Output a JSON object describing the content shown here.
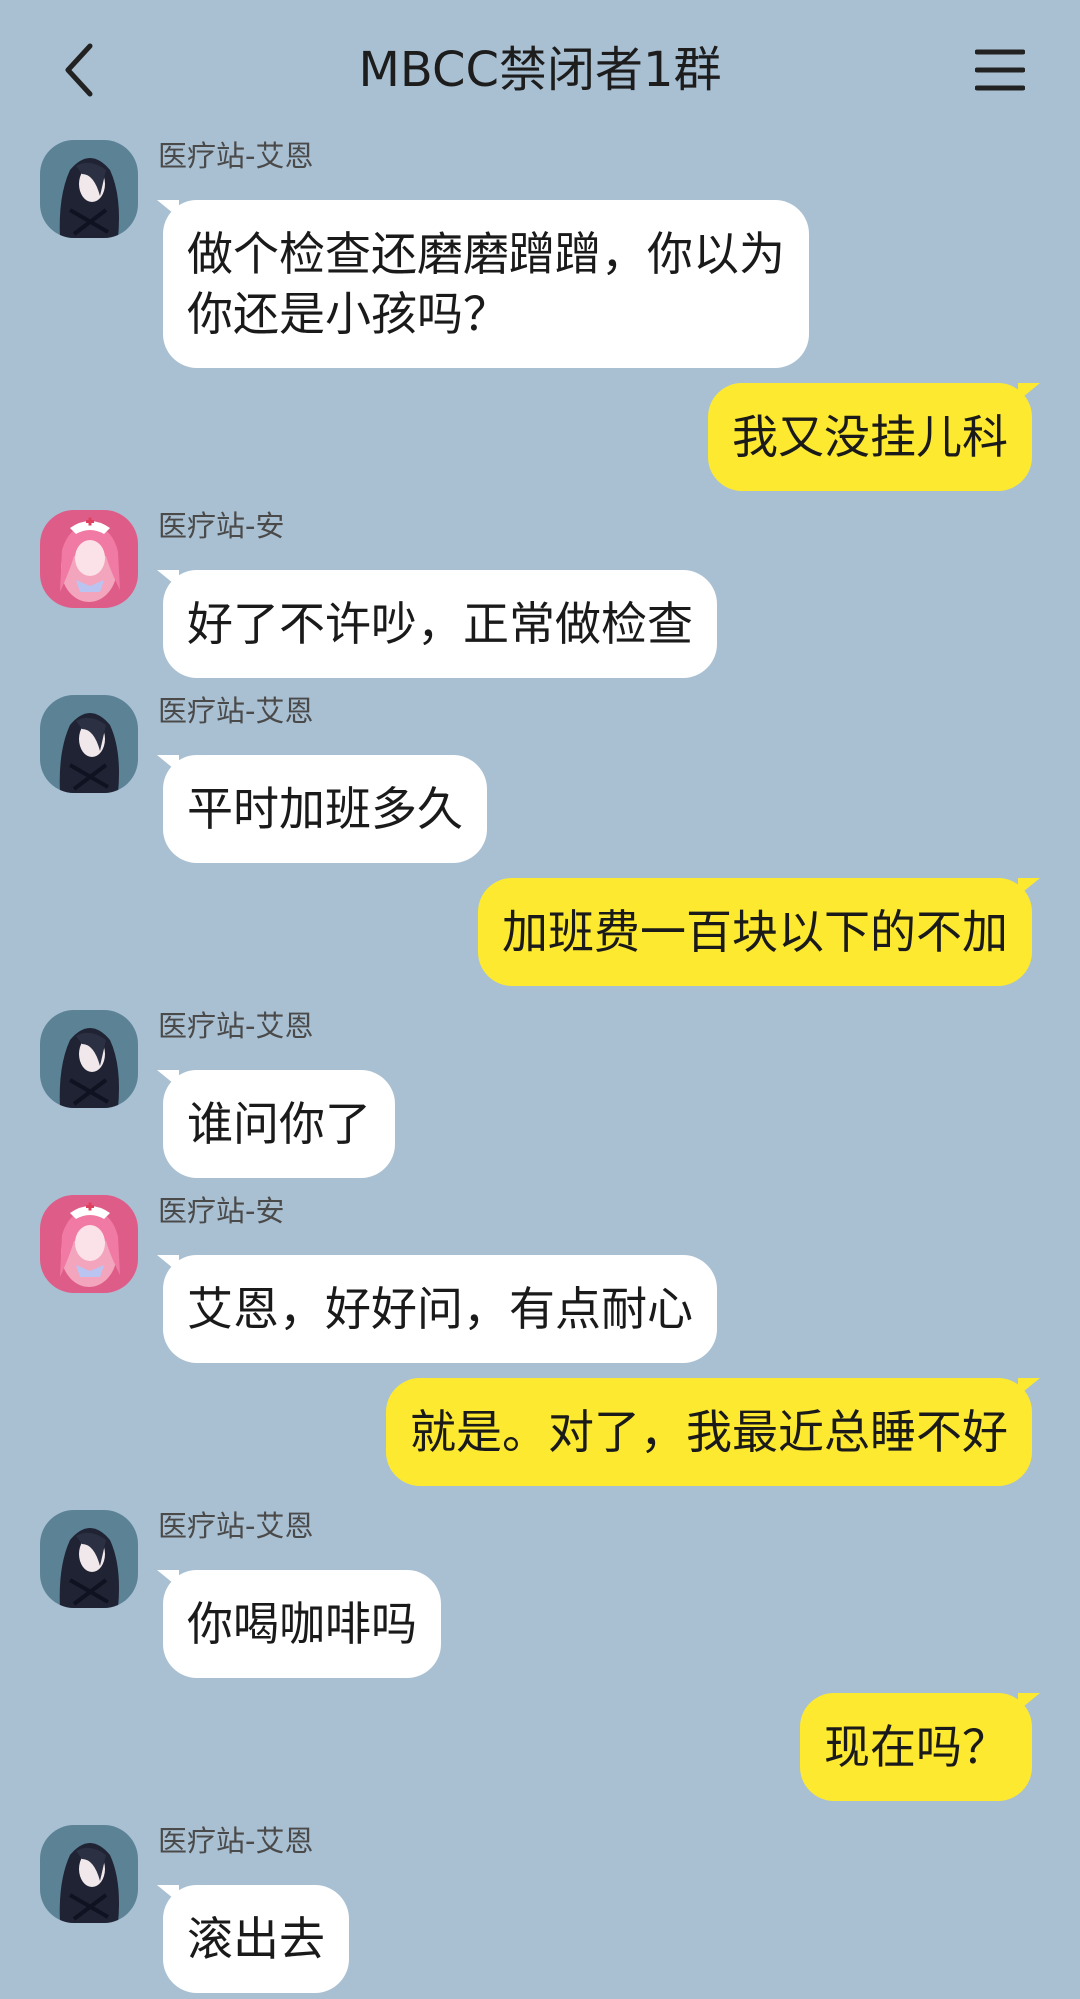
{
  "header": {
    "title": "MBCC禁闭者1群",
    "back_icon": "chevron-left-icon",
    "menu_icon": "hamburger-menu-icon"
  },
  "colors": {
    "background": "#a9c0d3",
    "incoming_bubble": "#ffffff",
    "outgoing_bubble": "#fde92f"
  },
  "messages": [
    {
      "direction": "in",
      "sender": "医疗站-艾恩",
      "avatar": "dark-haired-avatar",
      "lines": [
        "做个检查还磨磨蹭蹭，你以为",
        "你还是小孩吗？"
      ]
    },
    {
      "direction": "out",
      "lines": [
        "我又没挂儿科"
      ]
    },
    {
      "direction": "in",
      "sender": "医疗站-安",
      "avatar": "pink-haired-nurse-avatar",
      "lines": [
        "好了不许吵，正常做检查"
      ]
    },
    {
      "direction": "in",
      "sender": "医疗站-艾恩",
      "avatar": "dark-haired-avatar",
      "lines": [
        "平时加班多久"
      ]
    },
    {
      "direction": "out",
      "lines": [
        "加班费一百块以下的不加"
      ]
    },
    {
      "direction": "in",
      "sender": "医疗站-艾恩",
      "avatar": "dark-haired-avatar",
      "lines": [
        "谁问你了"
      ]
    },
    {
      "direction": "in",
      "sender": "医疗站-安",
      "avatar": "pink-haired-nurse-avatar",
      "lines": [
        "艾恩，好好问，有点耐心"
      ]
    },
    {
      "direction": "out",
      "lines": [
        "就是。对了，我最近总睡不好"
      ]
    },
    {
      "direction": "in",
      "sender": "医疗站-艾恩",
      "avatar": "dark-haired-avatar",
      "lines": [
        "你喝咖啡吗"
      ]
    },
    {
      "direction": "out",
      "lines": [
        "现在吗？"
      ]
    },
    {
      "direction": "in",
      "sender": "医疗站-艾恩",
      "avatar": "dark-haired-avatar",
      "lines": [
        "滚出去"
      ]
    }
  ]
}
